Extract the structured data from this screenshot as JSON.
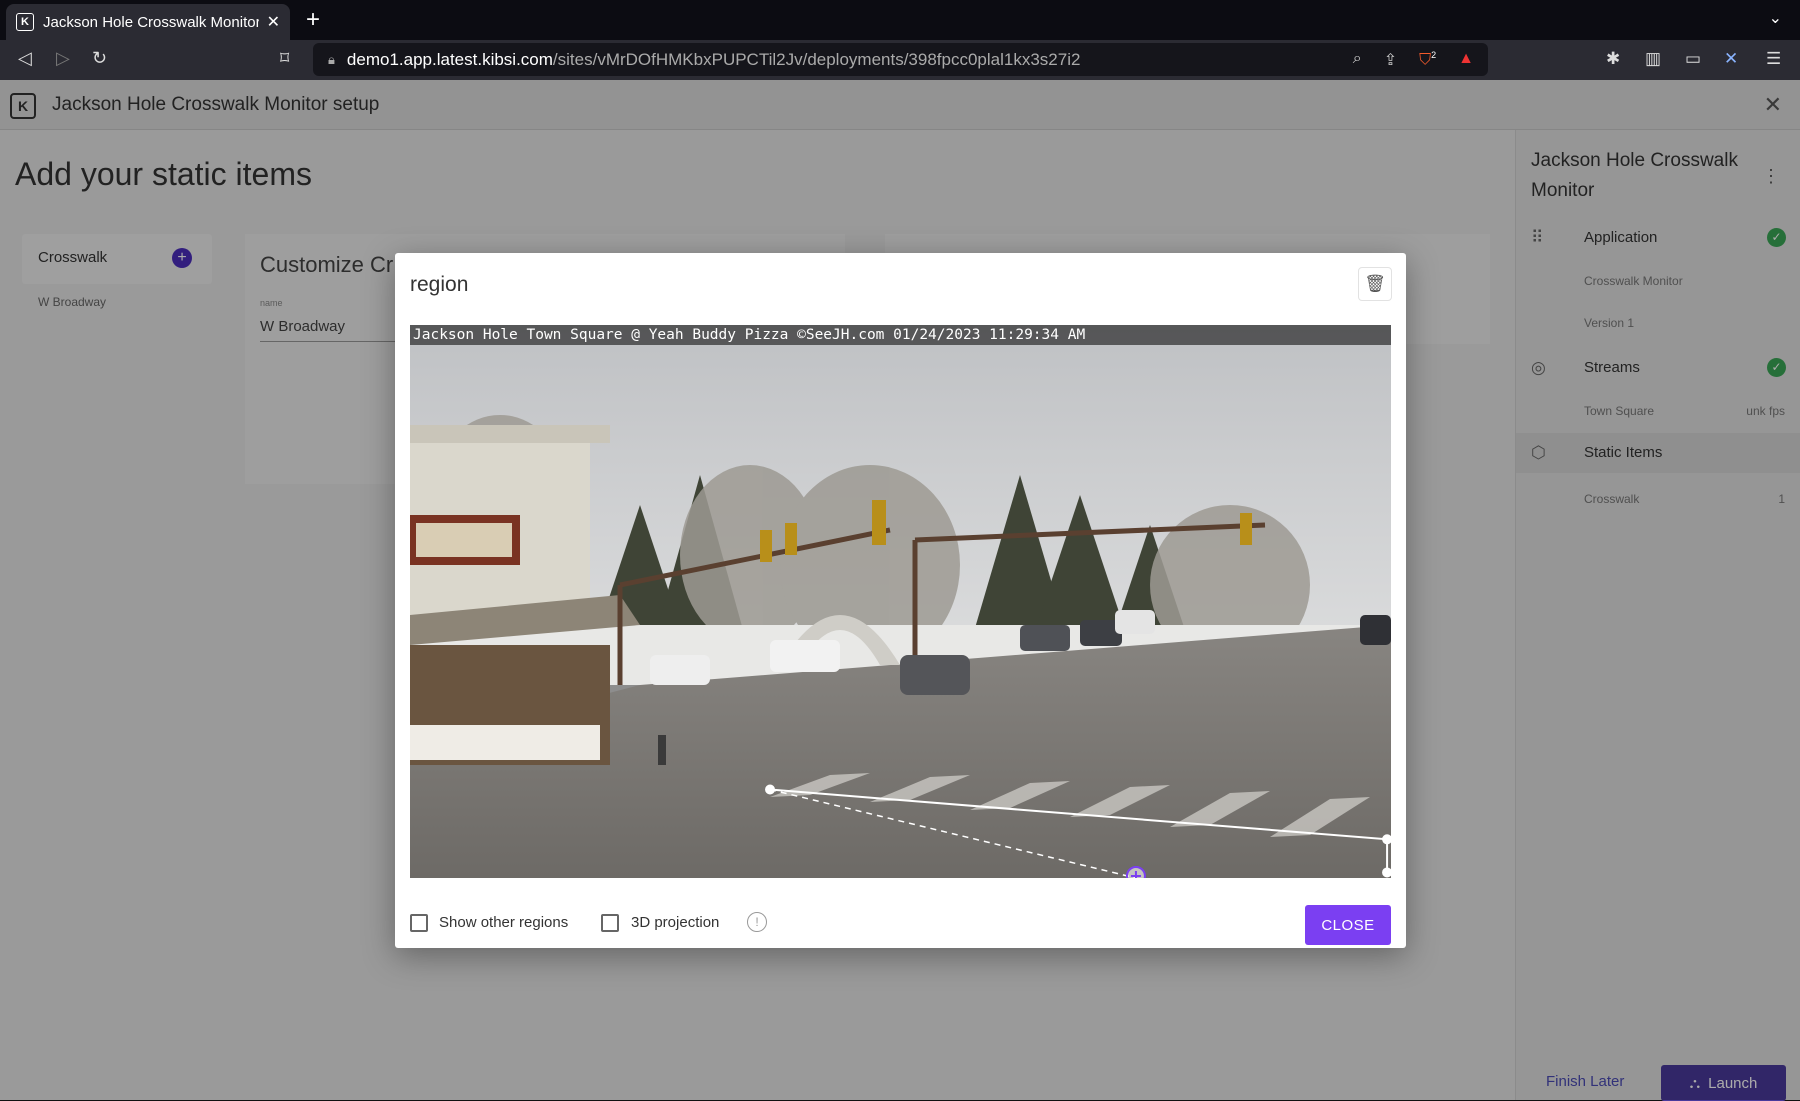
{
  "browser": {
    "tab_title": "Jackson Hole Crosswalk Monitor setup",
    "new_tab": "+",
    "tab_close": "✕",
    "url_host": "demo1.app.latest.kibsi.com",
    "url_path": "/sites/vMrDOfHMKbxPUPCTil2Jv/deployments/398fpcc0plal1kx3s27i2",
    "badge_count": "2"
  },
  "app": {
    "title": "Jackson Hole Crosswalk Monitor setup",
    "close": "✕"
  },
  "main": {
    "page_title": "Add your static items",
    "item_name": "Crosswalk",
    "item_sub": "W Broadway",
    "customize_title": "Customize Cr",
    "field_label": "name",
    "field_value": "W Broadway"
  },
  "sidebar": {
    "title": "Jackson Hole Crosswalk Monitor",
    "application": {
      "label": "Application",
      "sub1": "Crosswalk Monitor",
      "sub2": "Version 1"
    },
    "streams": {
      "label": "Streams",
      "sub": "Town Square",
      "sub_right": "unk fps"
    },
    "static_items": {
      "label": "Static Items",
      "sub": "Crosswalk",
      "sub_right": "1"
    },
    "finish_later": "Finish Later",
    "launch": "Launch"
  },
  "modal": {
    "title": "region",
    "camera_overlay": "Jackson Hole Town Square @ Yeah Buddy Pizza ©SeeJH.com 01/24/2023 11:29:34 AM",
    "show_other_regions": "Show other regions",
    "projection_3d": "3D projection",
    "close_button": "CLOSE"
  },
  "region_polygon": {
    "points": [
      [
        0.367,
        0.84
      ],
      [
        0.996,
        0.93
      ],
      [
        0.996,
        0.99
      ],
      [
        0.74,
        1.0
      ]
    ],
    "handle_color": "#7b3ff2"
  },
  "colors": {
    "accent": "#7b3ff2",
    "success": "#3aa655",
    "brand": "#4b2dbd"
  }
}
